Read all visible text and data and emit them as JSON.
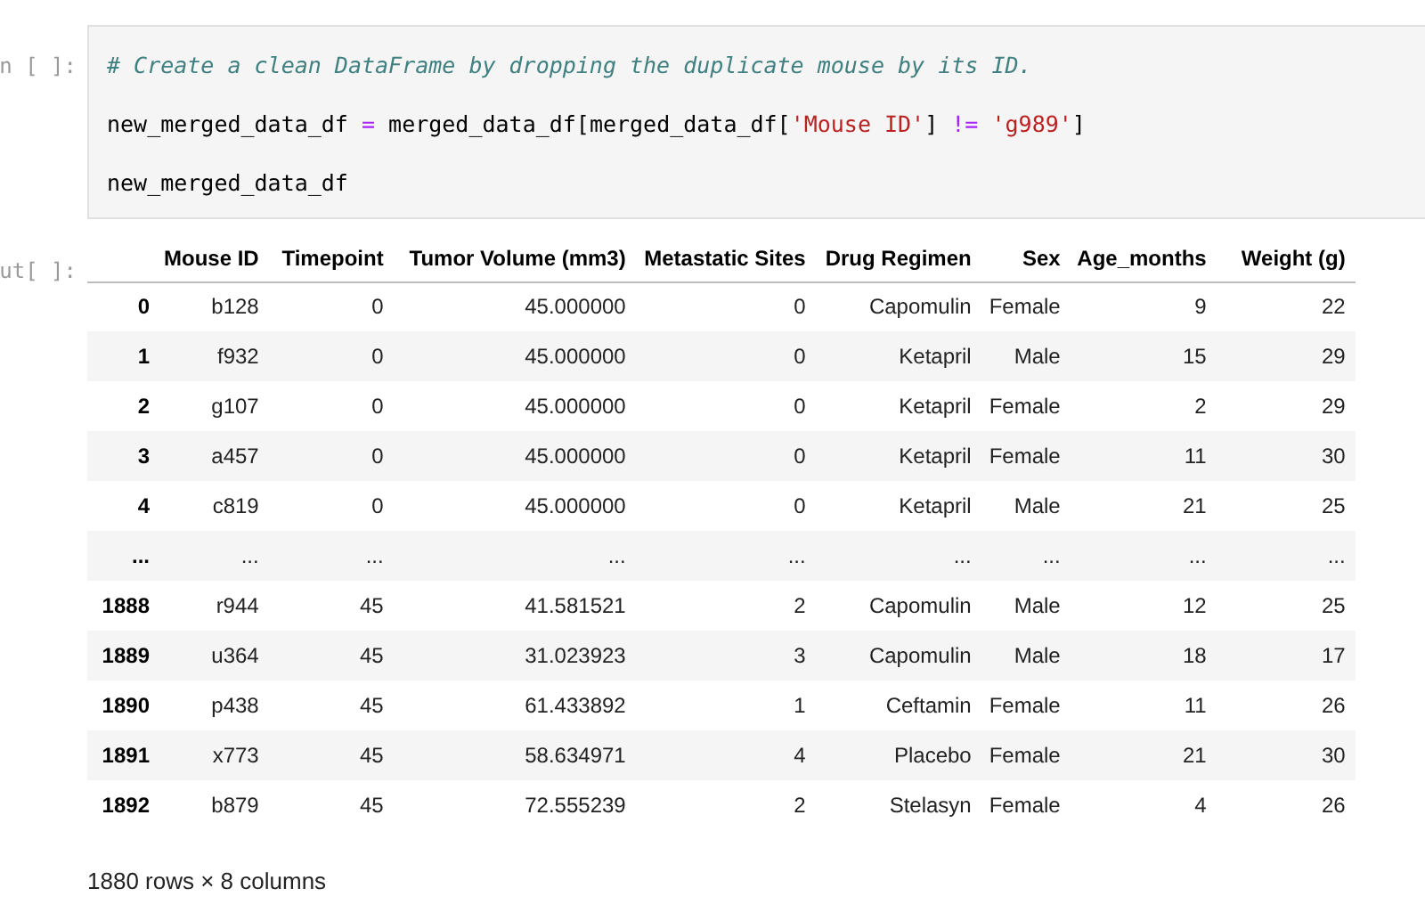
{
  "input_cell": {
    "prompt": "n [ ]:",
    "lines": [
      [
        {
          "kind": "comment",
          "text": "# Create a clean DataFrame by dropping the duplicate mouse by its ID."
        }
      ],
      [
        {
          "kind": "plain",
          "text": "new_merged_data_df "
        },
        {
          "kind": "operator",
          "text": "="
        },
        {
          "kind": "plain",
          "text": " merged_data_df[merged_data_df["
        },
        {
          "kind": "string",
          "text": "'Mouse ID'"
        },
        {
          "kind": "plain",
          "text": "] "
        },
        {
          "kind": "operator",
          "text": "!="
        },
        {
          "kind": "string",
          "text": " 'g989'"
        },
        {
          "kind": "plain",
          "text": "]"
        }
      ],
      [
        {
          "kind": "plain",
          "text": "new_merged_data_df"
        }
      ]
    ]
  },
  "output_cell": {
    "prompt": "ut[ ]:",
    "table": {
      "columns": [
        "Mouse ID",
        "Timepoint",
        "Tumor Volume (mm3)",
        "Metastatic Sites",
        "Drug Regimen",
        "Sex",
        "Age_months",
        "Weight (g)"
      ],
      "rows": [
        {
          "index": "0",
          "cells": [
            "b128",
            "0",
            "45.000000",
            "0",
            "Capomulin",
            "Female",
            "9",
            "22"
          ]
        },
        {
          "index": "1",
          "cells": [
            "f932",
            "0",
            "45.000000",
            "0",
            "Ketapril",
            "Male",
            "15",
            "29"
          ]
        },
        {
          "index": "2",
          "cells": [
            "g107",
            "0",
            "45.000000",
            "0",
            "Ketapril",
            "Female",
            "2",
            "29"
          ]
        },
        {
          "index": "3",
          "cells": [
            "a457",
            "0",
            "45.000000",
            "0",
            "Ketapril",
            "Female",
            "11",
            "30"
          ]
        },
        {
          "index": "4",
          "cells": [
            "c819",
            "0",
            "45.000000",
            "0",
            "Ketapril",
            "Male",
            "21",
            "25"
          ]
        },
        {
          "index": "...",
          "cells": [
            "...",
            "...",
            "...",
            "...",
            "...",
            "...",
            "...",
            "..."
          ]
        },
        {
          "index": "1888",
          "cells": [
            "r944",
            "45",
            "41.581521",
            "2",
            "Capomulin",
            "Male",
            "12",
            "25"
          ]
        },
        {
          "index": "1889",
          "cells": [
            "u364",
            "45",
            "31.023923",
            "3",
            "Capomulin",
            "Male",
            "18",
            "17"
          ]
        },
        {
          "index": "1890",
          "cells": [
            "p438",
            "45",
            "61.433892",
            "1",
            "Ceftamin",
            "Female",
            "11",
            "26"
          ]
        },
        {
          "index": "1891",
          "cells": [
            "x773",
            "45",
            "58.634971",
            "4",
            "Placebo",
            "Female",
            "21",
            "30"
          ]
        },
        {
          "index": "1892",
          "cells": [
            "b879",
            "45",
            "72.555239",
            "2",
            "Stelasyn",
            "Female",
            "4",
            "26"
          ]
        }
      ]
    },
    "summary": "1880 rows × 8 columns"
  }
}
